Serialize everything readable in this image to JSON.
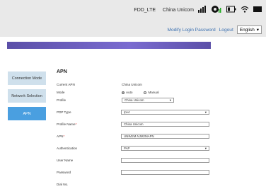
{
  "status": {
    "network": "FDD_LTE",
    "carrier": "China Unicom"
  },
  "header": {
    "modify_password": "Modify Login Password",
    "logout": "Logout",
    "language": "English"
  },
  "sidebar": {
    "items": [
      {
        "label": "Connection Mode",
        "active": false
      },
      {
        "label": "Network Selection",
        "active": false
      },
      {
        "label": "APN",
        "active": true
      }
    ]
  },
  "apn": {
    "title": "APN",
    "current_apn_label": "Current APN",
    "current_apn_value": "China Unicom",
    "mode_label": "Mode",
    "mode_auto": "Auto",
    "mode_manual": "Manual",
    "profile_label": "Profile",
    "profile_value": "China Unicom",
    "pdp_type_label": "PDP Type",
    "pdp_type_value": "Ipv4",
    "profile_name_label": "Profile Name",
    "profile_name_value": "China Unicom",
    "apn_label": "APN",
    "apn_value": "UNIM2M.NJM2MAPN",
    "authentication_label": "Authentication",
    "authentication_value": "PAP",
    "username_label": "User Name",
    "username_value": "",
    "password_label": "Password",
    "password_value": "",
    "dial_no_label": "Dial No."
  }
}
